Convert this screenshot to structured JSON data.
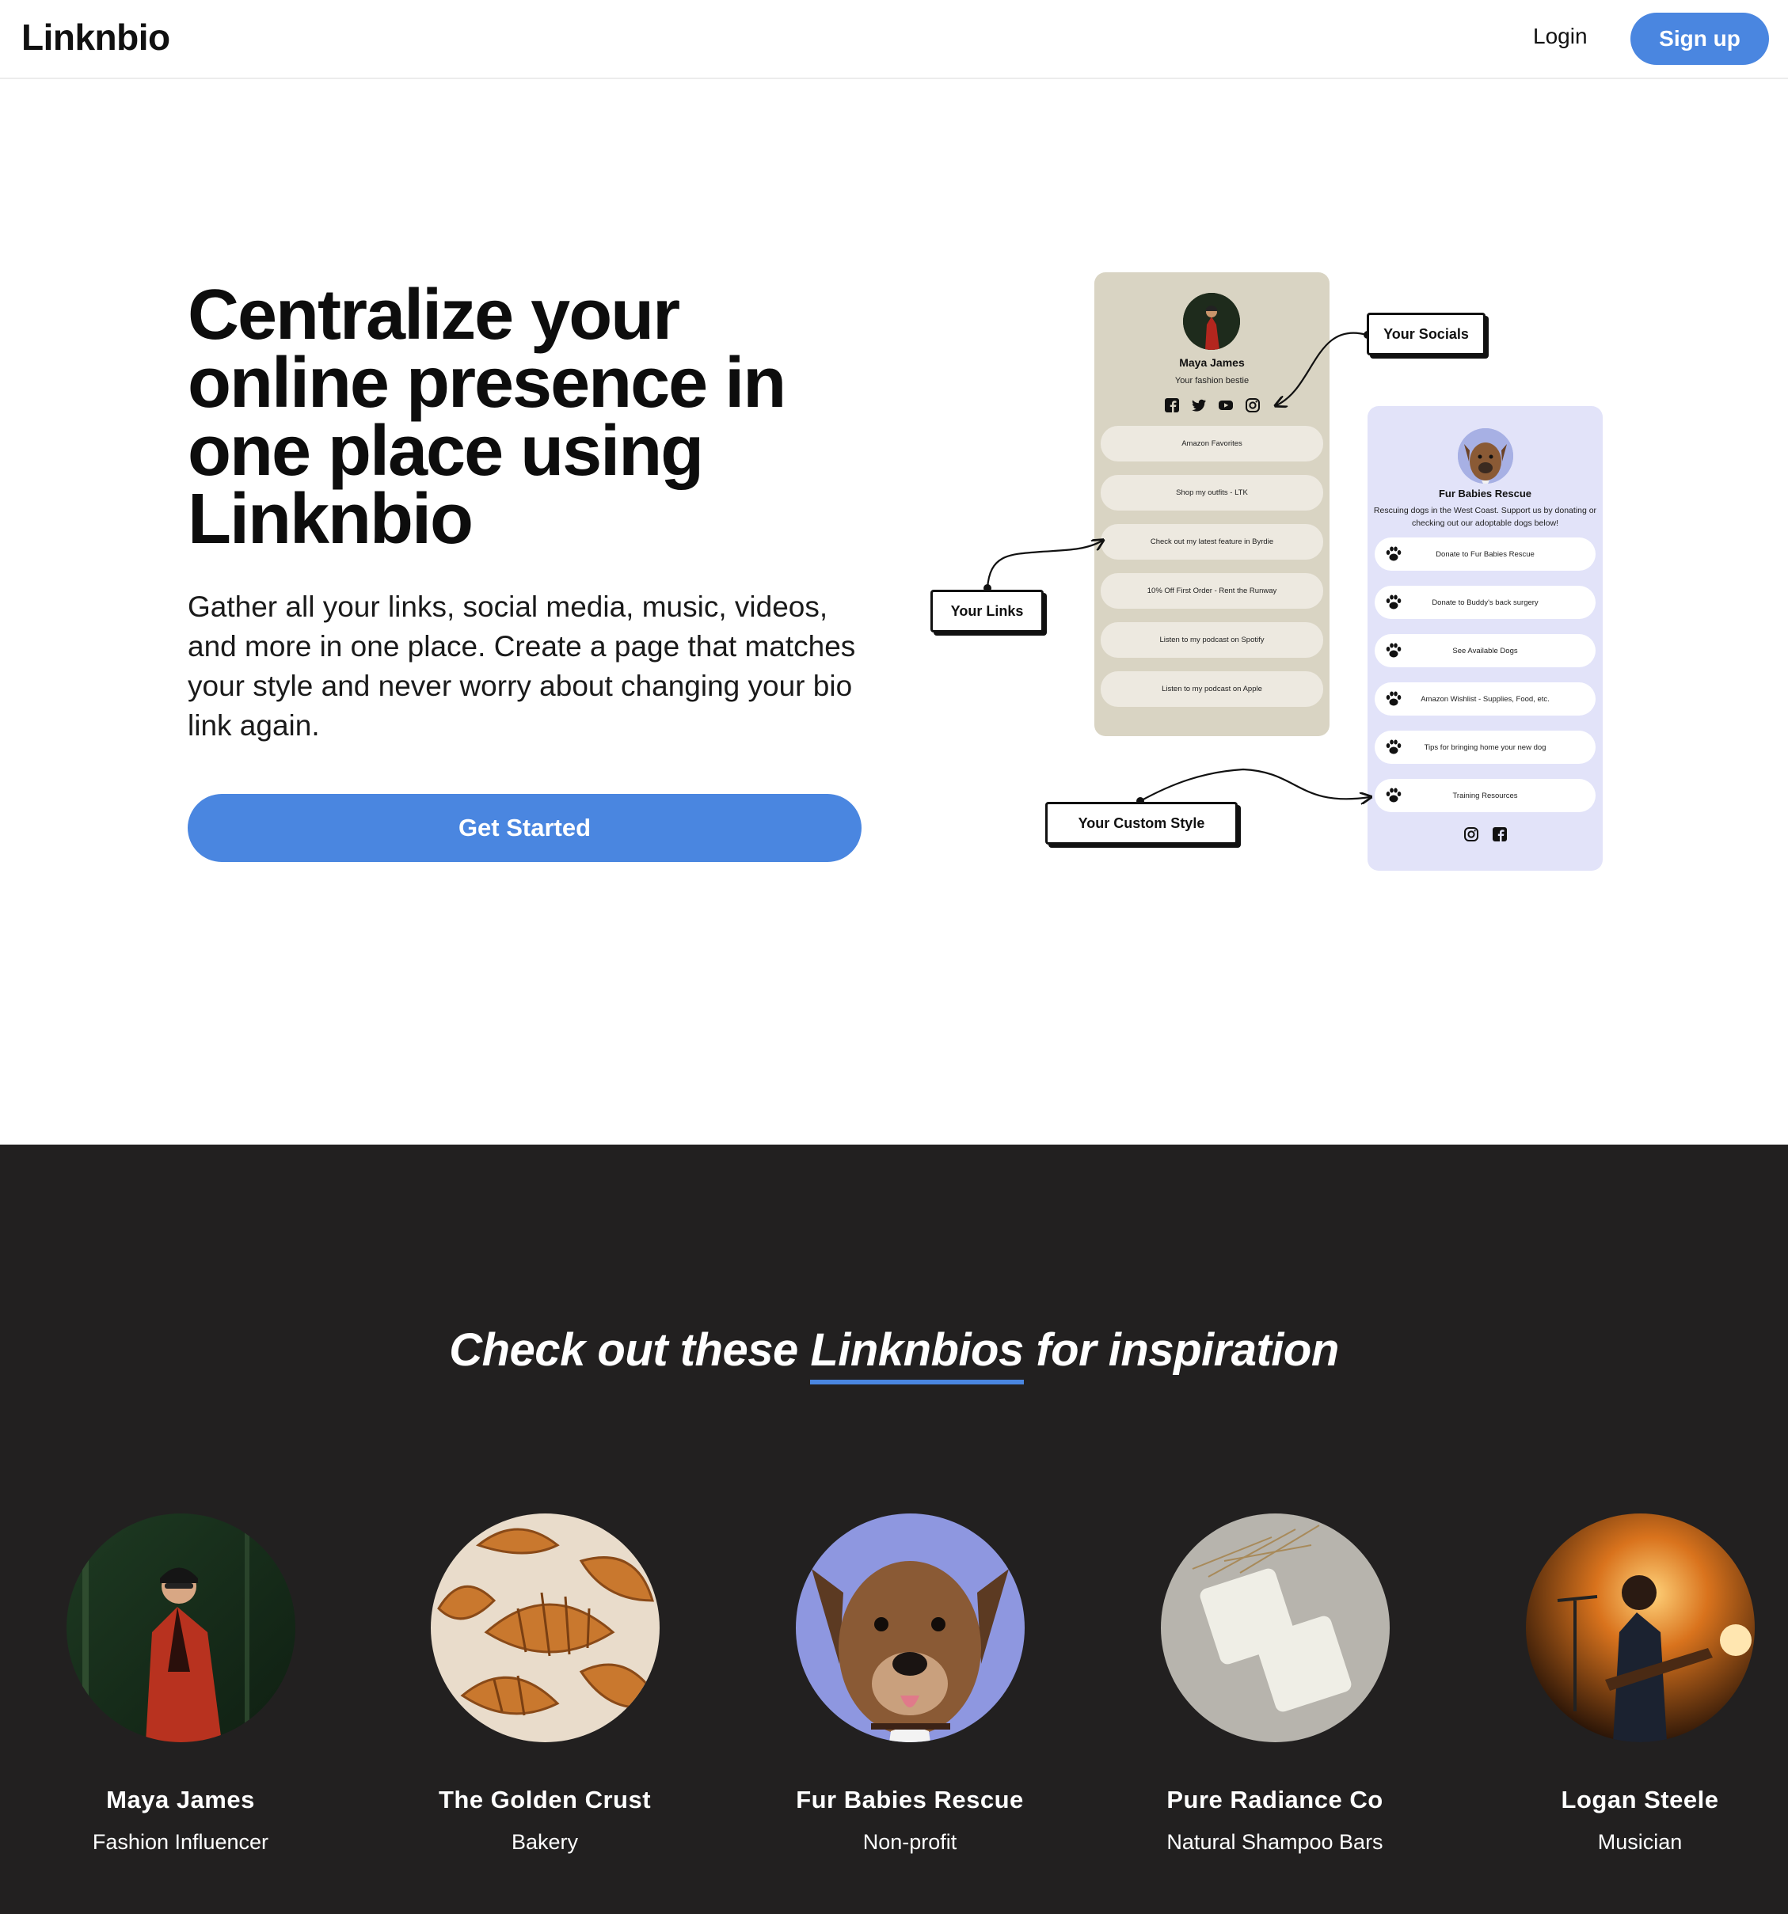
{
  "header": {
    "logo": "Linknbio",
    "login_label": "Login",
    "signup_label": "Sign up"
  },
  "hero": {
    "title": "Centralize your online presence in one place using Linknbio",
    "subtitle": "Gather all your links, social media, music, videos, and more in one place. Create a page that matches your style and never worry about changing your bio link again.",
    "cta_label": "Get Started"
  },
  "illustration": {
    "phone1": {
      "name": "Maya James",
      "bio": "Your fashion bestie",
      "links": [
        "Amazon Favorites",
        "Shop my outfits - LTK",
        "Check out my latest feature in Byrdie",
        "10% Off First Order - Rent the Runway",
        "Listen to my podcast on Spotify",
        "Listen to my podcast on Apple"
      ],
      "socials": [
        "facebook-icon",
        "twitter-icon",
        "youtube-icon",
        "instagram-icon"
      ]
    },
    "phone2": {
      "name": "Fur Babies Rescue",
      "bio": "Rescuing dogs in the West Coast. Support us by donating or checking out our adoptable dogs below!",
      "links": [
        "Donate to Fur Babies Rescue",
        "Donate to Buddy's back surgery",
        "See Available Dogs",
        "Amazon Wishlist - Supplies, Food, etc.",
        "Tips for bringing home your new dog",
        "Training Resources"
      ],
      "socials": [
        "instagram-icon",
        "facebook-icon"
      ]
    },
    "callouts": {
      "socials": "Your Socials",
      "links": "Your Links",
      "style": "Your Custom Style"
    }
  },
  "inspiration": {
    "title_before": "Check out these ",
    "title_highlight": "Linknbios",
    "title_after": " for inspiration",
    "accent_color": "#4a86e0",
    "cards": [
      {
        "name": "Maya James",
        "category": "Fashion Influencer"
      },
      {
        "name": "The Golden Crust",
        "category": "Bakery"
      },
      {
        "name": "Fur Babies Rescue",
        "category": "Non-profit"
      },
      {
        "name": "Pure Radiance Co",
        "category": "Natural Shampoo Bars"
      },
      {
        "name": "Logan Steele",
        "category": "Musician"
      }
    ]
  }
}
